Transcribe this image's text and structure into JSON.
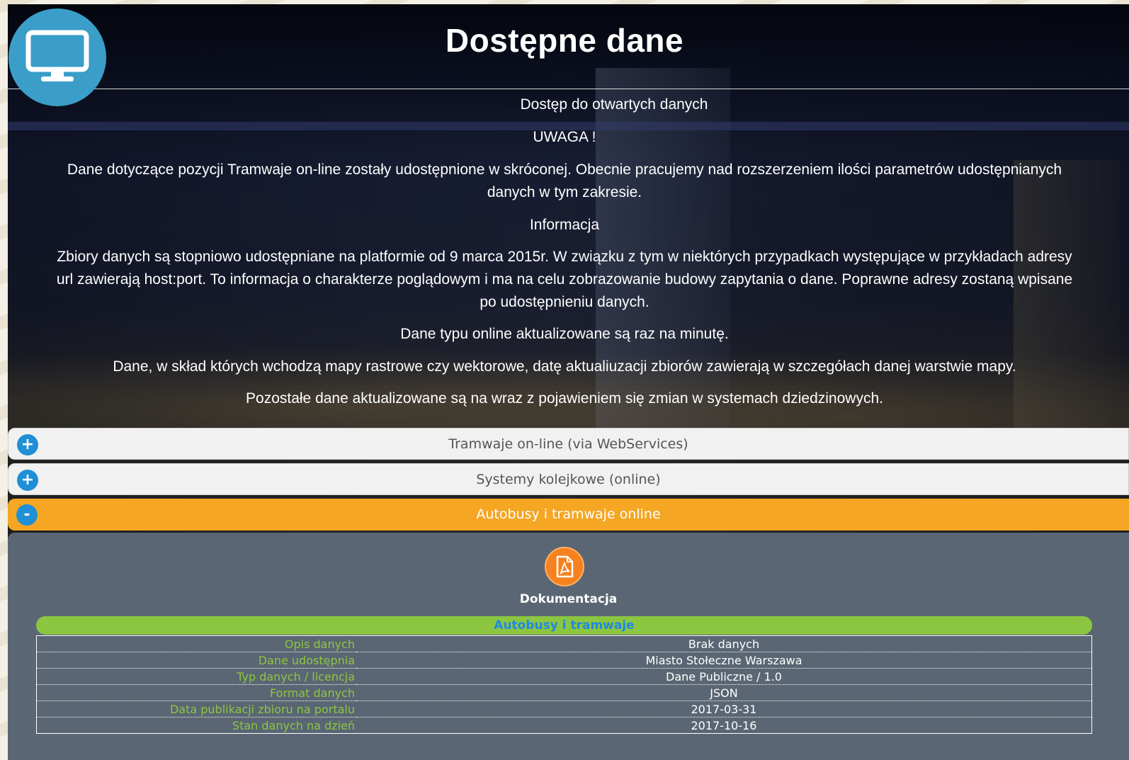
{
  "header": {
    "title": "Dostępne dane",
    "logo_icon": "monitor-icon",
    "subtitle": "Dostęp do otwartych danych"
  },
  "notices": {
    "warning_heading": "UWAGA !",
    "warning_text_line1": "Dane dotyczące pozycji Tramwaje on-line zostały udostępnione w skróconej. Obecnie pracujemy nad rozszerzeniem ilości parametrów udostępnianych",
    "warning_text_line2": "danych w tym zakresie.",
    "info_heading": "Informacja",
    "info_text_line1": "Zbiory danych są stopniowo udostępniane na platformie od 9 marca 2015r. W związku z tym w niektórych przypadkach występujące w przykładach adresy",
    "info_text_line2": "url zawierają host:port. To informacja o charakterze poglądowym i ma na celu zobrazowanie budowy zapytania o dane. Poprawne adresy zostaną wpisane",
    "info_text_line3": "po udostępnieniu danych.",
    "online_update": "Dane typu online aktualizowane są raz na minutę.",
    "maps_update": "Dane, w skład których wchodzą mapy rastrowe czy wektorowe, datę aktualiuzacji zbiorów zawierają w szczegółach danej warstwie mapy.",
    "other_update": "Pozostałe dane aktualizowane są na wraz z pojawieniem się zmian w systemach dziedzinowych."
  },
  "accordion": [
    {
      "label": "Tramwaje on-line (via WebServices)",
      "toggle": "+",
      "expanded": false
    },
    {
      "label": "Systemy kolejkowe (online)",
      "toggle": "+",
      "expanded": false
    },
    {
      "label": "Autobusy i tramwaje online",
      "toggle": "-",
      "expanded": true
    }
  ],
  "detail": {
    "doc_icon": "pdf-icon",
    "doc_label": "Dokumentacja",
    "section_title": "Autobusy i tramwaje",
    "rows": [
      {
        "key": "Opis danych",
        "value": "Brak danych"
      },
      {
        "key": "Dane udostępnia",
        "value": "Miasto Stołeczne Warszawa"
      },
      {
        "key": "Typ danych / licencja",
        "value": "Dane Publiczne / 1.0"
      },
      {
        "key": "Format danych",
        "value": "JSON"
      },
      {
        "key": "Data publikacji zbioru na portalu",
        "value": "2017-03-31"
      },
      {
        "key": "Stan danych na dzień",
        "value": "2017-10-16"
      }
    ]
  },
  "colors": {
    "active_accent": "#f5a623",
    "toggle_blue": "#1f8fd6",
    "label_green": "#8cc641",
    "detail_bg": "#5a6673"
  }
}
